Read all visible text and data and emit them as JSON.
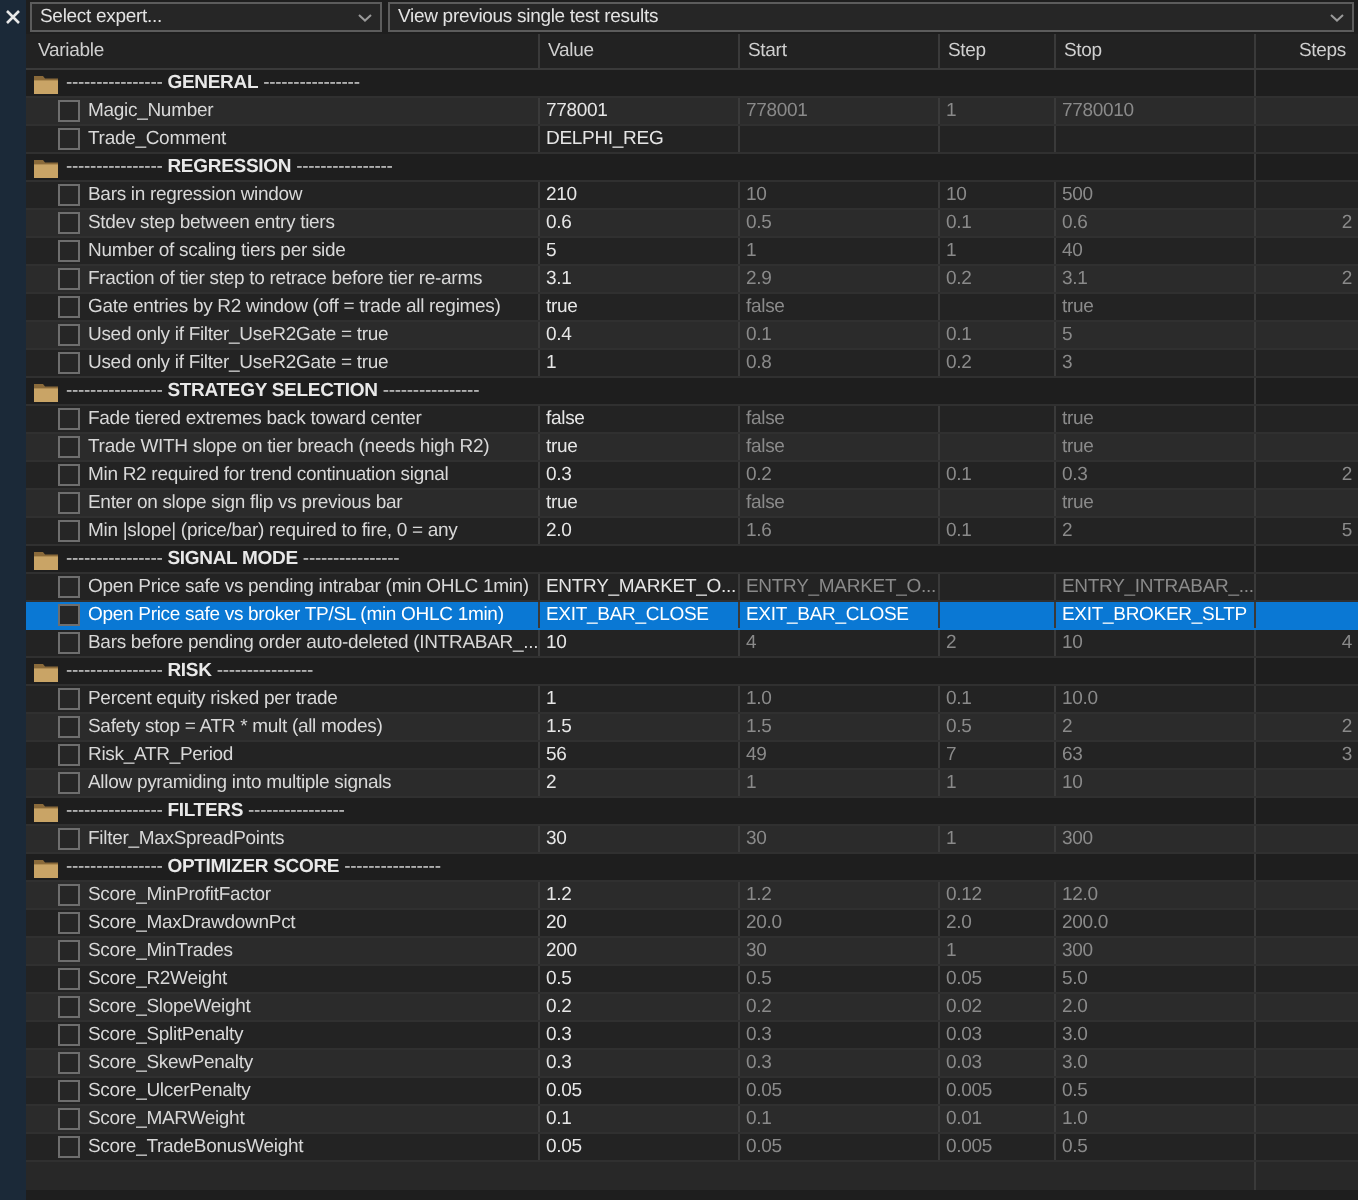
{
  "toolbar": {
    "expert_select": {
      "placeholder": "Select expert..."
    },
    "results_select": {
      "value": "View previous single test results"
    }
  },
  "table": {
    "columns": [
      "Variable",
      "Value",
      "Start",
      "Step",
      "Stop",
      "Steps"
    ],
    "groups": [
      {
        "title": "---------------- **GENERAL** ----------------",
        "rows": [
          {
            "variable": "Magic_Number",
            "checked": false,
            "selected": false,
            "value": "778001",
            "start": "778001",
            "step": "1",
            "stop": "7780010"
          },
          {
            "variable": "Trade_Comment",
            "checked": false,
            "selected": false,
            "value": "DELPHI_REG"
          }
        ]
      },
      {
        "title": "---------------- **REGRESSION** ----------------",
        "rows": [
          {
            "variable": "Bars in regression window",
            "checked": false,
            "selected": false,
            "value": "210",
            "start": "10",
            "step": "10",
            "stop": "500"
          },
          {
            "variable": "Stdev step between entry tiers",
            "checked": false,
            "selected": false,
            "value": "0.6",
            "start": "0.5",
            "step": "0.1",
            "stop": "0.6",
            "steps": "2"
          },
          {
            "variable": "Number of scaling tiers per side",
            "checked": false,
            "selected": false,
            "value": "5",
            "start": "1",
            "step": "1",
            "stop": "40"
          },
          {
            "variable": "Fraction of tier step to retrace before tier re-arms",
            "checked": false,
            "selected": false,
            "value": "3.1",
            "start": "2.9",
            "step": "0.2",
            "stop": "3.1",
            "steps": "2"
          },
          {
            "variable": "Gate entries by R2 window (off = trade all regimes)",
            "checked": false,
            "selected": false,
            "value": "true",
            "start": "false",
            "stop": "true"
          },
          {
            "variable": "Used only if Filter_UseR2Gate = true",
            "checked": false,
            "selected": false,
            "value": "0.4",
            "start": "0.1",
            "step": "0.1",
            "stop": "5"
          },
          {
            "variable": "Used only if Filter_UseR2Gate = true",
            "checked": false,
            "selected": false,
            "value": "1",
            "start": "0.8",
            "step": "0.2",
            "stop": "3"
          }
        ]
      },
      {
        "title": "---------------- **STRATEGY SELECTION** ----------------",
        "rows": [
          {
            "variable": "Fade tiered extremes back toward center",
            "checked": false,
            "selected": false,
            "value": "false",
            "start": "false",
            "stop": "true"
          },
          {
            "variable": "Trade WITH slope on tier breach (needs high R2)",
            "checked": false,
            "selected": false,
            "value": "true",
            "start": "false",
            "stop": "true"
          },
          {
            "variable": "Min R2 required for trend continuation signal",
            "checked": false,
            "selected": false,
            "value": "0.3",
            "start": "0.2",
            "step": "0.1",
            "stop": "0.3",
            "steps": "2"
          },
          {
            "variable": "Enter on slope sign flip vs previous bar",
            "checked": false,
            "selected": false,
            "value": "true",
            "start": "false",
            "stop": "true"
          },
          {
            "variable": "Min |slope| (price/bar) required to fire, 0 = any",
            "checked": false,
            "selected": false,
            "value": "2.0",
            "start": "1.6",
            "step": "0.1",
            "stop": "2",
            "steps": "5"
          }
        ]
      },
      {
        "title": "---------------- **SIGNAL MODE** ----------------",
        "rows": [
          {
            "variable": "Open Price safe vs pending intrabar (min OHLC 1min)",
            "checked": false,
            "selected": false,
            "value": "ENTRY_MARKET_O...",
            "start": "ENTRY_MARKET_O...",
            "stop": "ENTRY_INTRABAR_..."
          },
          {
            "variable": "Open Price safe vs broker TP/SL (min OHLC 1min)",
            "checked": false,
            "selected": true,
            "value": "EXIT_BAR_CLOSE",
            "start": "EXIT_BAR_CLOSE",
            "stop": "EXIT_BROKER_SLTP"
          },
          {
            "variable": "Bars before pending order auto-deleted (INTRABAR_...",
            "checked": false,
            "selected": false,
            "value": "10",
            "start": "4",
            "step": "2",
            "stop": "10",
            "steps": "4"
          }
        ]
      },
      {
        "title": "---------------- **RISK** ----------------",
        "rows": [
          {
            "variable": "Percent equity risked per trade",
            "checked": false,
            "selected": false,
            "value": "1",
            "start": "1.0",
            "step": "0.1",
            "stop": "10.0"
          },
          {
            "variable": "Safety stop = ATR * mult (all modes)",
            "checked": false,
            "selected": false,
            "value": "1.5",
            "start": "1.5",
            "step": "0.5",
            "stop": "2",
            "steps": "2"
          },
          {
            "variable": "Risk_ATR_Period",
            "checked": false,
            "selected": false,
            "value": "56",
            "start": "49",
            "step": "7",
            "stop": "63",
            "steps": "3"
          },
          {
            "variable": "Allow pyramiding into multiple signals",
            "checked": false,
            "selected": false,
            "value": "2",
            "start": "1",
            "step": "1",
            "stop": "10"
          }
        ]
      },
      {
        "title": "---------------- **FILTERS** ----------------",
        "rows": [
          {
            "variable": "Filter_MaxSpreadPoints",
            "checked": false,
            "selected": false,
            "value": "30",
            "start": "30",
            "step": "1",
            "stop": "300"
          }
        ]
      },
      {
        "title": "---------------- **OPTIMIZER SCORE** ----------------",
        "rows": [
          {
            "variable": "Score_MinProfitFactor",
            "checked": false,
            "selected": false,
            "value": "1.2",
            "start": "1.2",
            "step": "0.12",
            "stop": "12.0"
          },
          {
            "variable": "Score_MaxDrawdownPct",
            "checked": false,
            "selected": false,
            "value": "20",
            "start": "20.0",
            "step": "2.0",
            "stop": "200.0"
          },
          {
            "variable": "Score_MinTrades",
            "checked": false,
            "selected": false,
            "value": "200",
            "start": "30",
            "step": "1",
            "stop": "300"
          },
          {
            "variable": "Score_R2Weight",
            "checked": false,
            "selected": false,
            "value": "0.5",
            "start": "0.5",
            "step": "0.05",
            "stop": "5.0"
          },
          {
            "variable": "Score_SlopeWeight",
            "checked": false,
            "selected": false,
            "value": "0.2",
            "start": "0.2",
            "step": "0.02",
            "stop": "2.0"
          },
          {
            "variable": "Score_SplitPenalty",
            "checked": false,
            "selected": false,
            "value": "0.3",
            "start": "0.3",
            "step": "0.03",
            "stop": "3.0"
          },
          {
            "variable": "Score_SkewPenalty",
            "checked": false,
            "selected": false,
            "value": "0.3",
            "start": "0.3",
            "step": "0.03",
            "stop": "3.0"
          },
          {
            "variable": "Score_UlcerPenalty",
            "checked": false,
            "selected": false,
            "value": "0.05",
            "start": "0.05",
            "step": "0.005",
            "stop": "0.5"
          },
          {
            "variable": "Score_MARWeight",
            "checked": false,
            "selected": false,
            "value": "0.1",
            "start": "0.1",
            "step": "0.01",
            "stop": "1.0"
          },
          {
            "variable": "Score_TradeBonusWeight",
            "checked": false,
            "selected": false,
            "value": "0.05",
            "start": "0.05",
            "step": "0.005",
            "stop": "0.5"
          }
        ]
      }
    ]
  }
}
